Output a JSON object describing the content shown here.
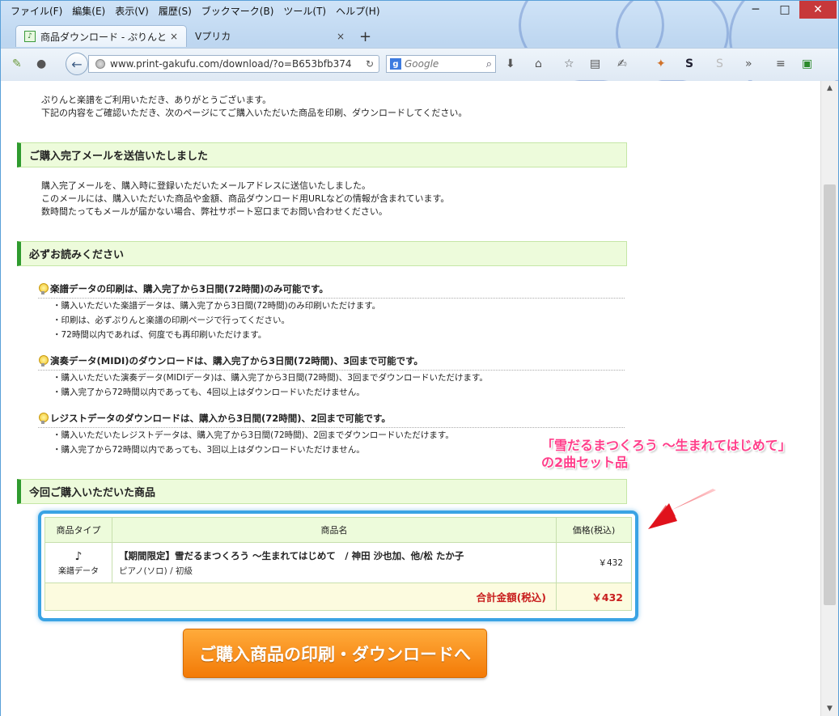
{
  "browser": {
    "menu": [
      "ファイル(F)",
      "編集(E)",
      "表示(V)",
      "履歴(S)",
      "ブックマーク(B)",
      "ツール(T)",
      "ヘルプ(H)"
    ],
    "tabs": [
      {
        "label": "商品ダウンロード - ぷりんと楽譜",
        "close": "×"
      },
      {
        "label": "Vプリカ",
        "close": "×"
      }
    ],
    "new_tab": "+",
    "url": "www.print-gakufu.com/download/?o=B653bfb374",
    "search_placeholder": "Google",
    "icons": [
      "back-icon",
      "reload-icon",
      "search-icon",
      "download-icon",
      "home-icon",
      "bookmark-star-icon",
      "reading-list-icon",
      "menu-icon"
    ]
  },
  "page": {
    "intro": [
      "ぷりんと楽譜をご利用いただき、ありがとうございます。",
      "下記の内容をご確認いただき、次のページにてご購入いただいた商品を印刷、ダウンロードしてください。"
    ],
    "section1": {
      "title": "ご購入完了メールを送信いたしました",
      "lines": [
        "購入完了メールを、購入時に登録いただいたメールアドレスに送信いたしました。",
        "このメールには、購入いただいた商品や金額、商品ダウンロード用URLなどの情報が含まれています。",
        "数時間たってもメールが届かない場合、弊社サポート窓口までお問い合わせください。"
      ]
    },
    "section2": {
      "title": "必ずお読みください",
      "notices": [
        {
          "title": "楽譜データの印刷は、購入完了から3日間(72時間)のみ可能です。",
          "items": [
            "・購入いただいた楽譜データは、購入完了から3日間(72時間)のみ印刷いただけます。",
            "・印刷は、必ずぷりんと楽譜の印刷ページで行ってください。",
            "・72時間以内であれば、何度でも再印刷いただけます。"
          ]
        },
        {
          "title": "演奏データ(MIDI)のダウンロードは、購入完了から3日間(72時間)、3回まで可能です。",
          "items": [
            "・購入いただいた演奏データ(MIDIデータ)は、購入完了から3日間(72時間)、3回までダウンロードいただけます。",
            "・購入完了から72時間以内であっても、4回以上はダウンロードいただけません。"
          ]
        },
        {
          "title": "レジストデータのダウンロードは、購入から3日間(72時間)、2回まで可能です。",
          "items": [
            "・購入いただいたレジストデータは、購入完了から3日間(72時間)、2回までダウンロードいただけます。",
            "・購入完了から72時間以内であっても、3回以上はダウンロードいただけません。"
          ]
        }
      ]
    },
    "section3": {
      "title": "今回ご購入いただいた商品",
      "table": {
        "headers": [
          "商品タイプ",
          "商品名",
          "価格(税込)"
        ],
        "row": {
          "type_icon": "♪",
          "type": "楽譜データ",
          "name": "【期間限定】雪だるまつくろう ～生まれてはじめて　/ 神田 沙也加、他/松 たか子",
          "desc": "ピアノ(ソロ) / 初級",
          "price": "￥432"
        },
        "total_label": "合計金額(税込)",
        "total_value": "￥432"
      }
    },
    "callout": [
      "「雪だるまつくろう ～生まれてはじめて」",
      "の2曲セット品"
    ],
    "cta": "ご購入商品の印刷・ダウンロードへ"
  },
  "colors": {
    "section_accent": "#2f9b2f",
    "section_bg": "#edfbdb",
    "highlight_border": "#3aa3e4",
    "callout_text": "#ff3e8a",
    "total_text": "#c81d1d",
    "cta_bg": "#f37a06"
  }
}
